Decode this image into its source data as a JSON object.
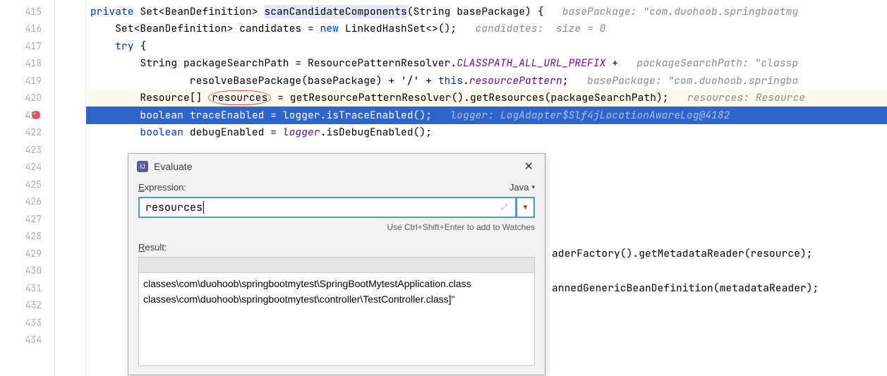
{
  "gutter": {
    "lines": [
      "415",
      "416",
      "417",
      "418",
      "419",
      "420",
      "421",
      "422",
      "423",
      "424",
      "425",
      "426",
      "427",
      "428",
      "429",
      "430",
      "431",
      "432",
      "433",
      "434"
    ],
    "breakpoint_line": "421"
  },
  "code": {
    "l415_kw": "private",
    "l415_type": " Set<BeanDefinition> ",
    "l415_method": "scanCandidateComponents",
    "l415_after": "(String basePackage) {",
    "l415_inlay": "   basePackage: \"com.duohoob.springbootmy",
    "l416_pre": "    Set<BeanDefinition> candidates = ",
    "l416_new": "new",
    "l416_post": " LinkedHashSet<>();",
    "l416_inlay": "   candidates:  size = 0",
    "l417_pre": "    ",
    "l417_try": "try",
    "l417_post": " {",
    "l418_pre": "        String packageSearchPath = ResourcePatternResolver.",
    "l418_const": "CLASSPATH_ALL_URL_PREFIX",
    "l418_post": " +",
    "l418_inlay": "   packageSearchPath: \"classp",
    "l419_pre": "                resolveBasePackage(basePackage) + ",
    "l419_str": "'/'",
    "l419_mid": " + ",
    "l419_this": "this",
    "l419_dot": ".",
    "l419_field": "resourcePattern",
    "l419_semi": ";",
    "l419_inlay": "   basePackage: \"com.duohoob.springbo",
    "l420_pre": "        Resource[] ",
    "l420_var": "resources",
    "l420_post": " = getResourcePatternResolver().getResources(packageSearchPath);",
    "l420_inlay": "   resources: Resource",
    "l421_pre": "        ",
    "l421_kw": "boolean",
    "l421_mid": " traceEnabled = ",
    "l421_logger": "logger",
    "l421_call": ".isTraceEnabled();",
    "l421_inlay": "   logger: LogAdapter$Slf4jLocationAwareLog@4182",
    "l422_pre": "        ",
    "l422_kw": "boolean",
    "l422_mid": " debugEnabled = ",
    "l422_logger": "logger",
    "l422_call": ".isDebugEnabled();",
    "l429_post": "aderFactory().getMetadataReader(resource);",
    "l431_post": "annedGenericBeanDefinition(metadataReader);"
  },
  "dialog": {
    "title": "Evaluate",
    "expr_label_pre": "E",
    "expr_label_post": "xpression:",
    "language": "Java",
    "expr_value": "resources",
    "hint": "Use Ctrl+Shift+Enter to add to Watches",
    "result_label_pre": "R",
    "result_label_post": "esult:",
    "result_line1": "classes\\com\\duohoob\\springbootmytest\\SpringBootMytestApplication.class",
    "result_line2": "classes\\com\\duohoob\\springbootmytest\\controller\\TestController.class]\""
  }
}
